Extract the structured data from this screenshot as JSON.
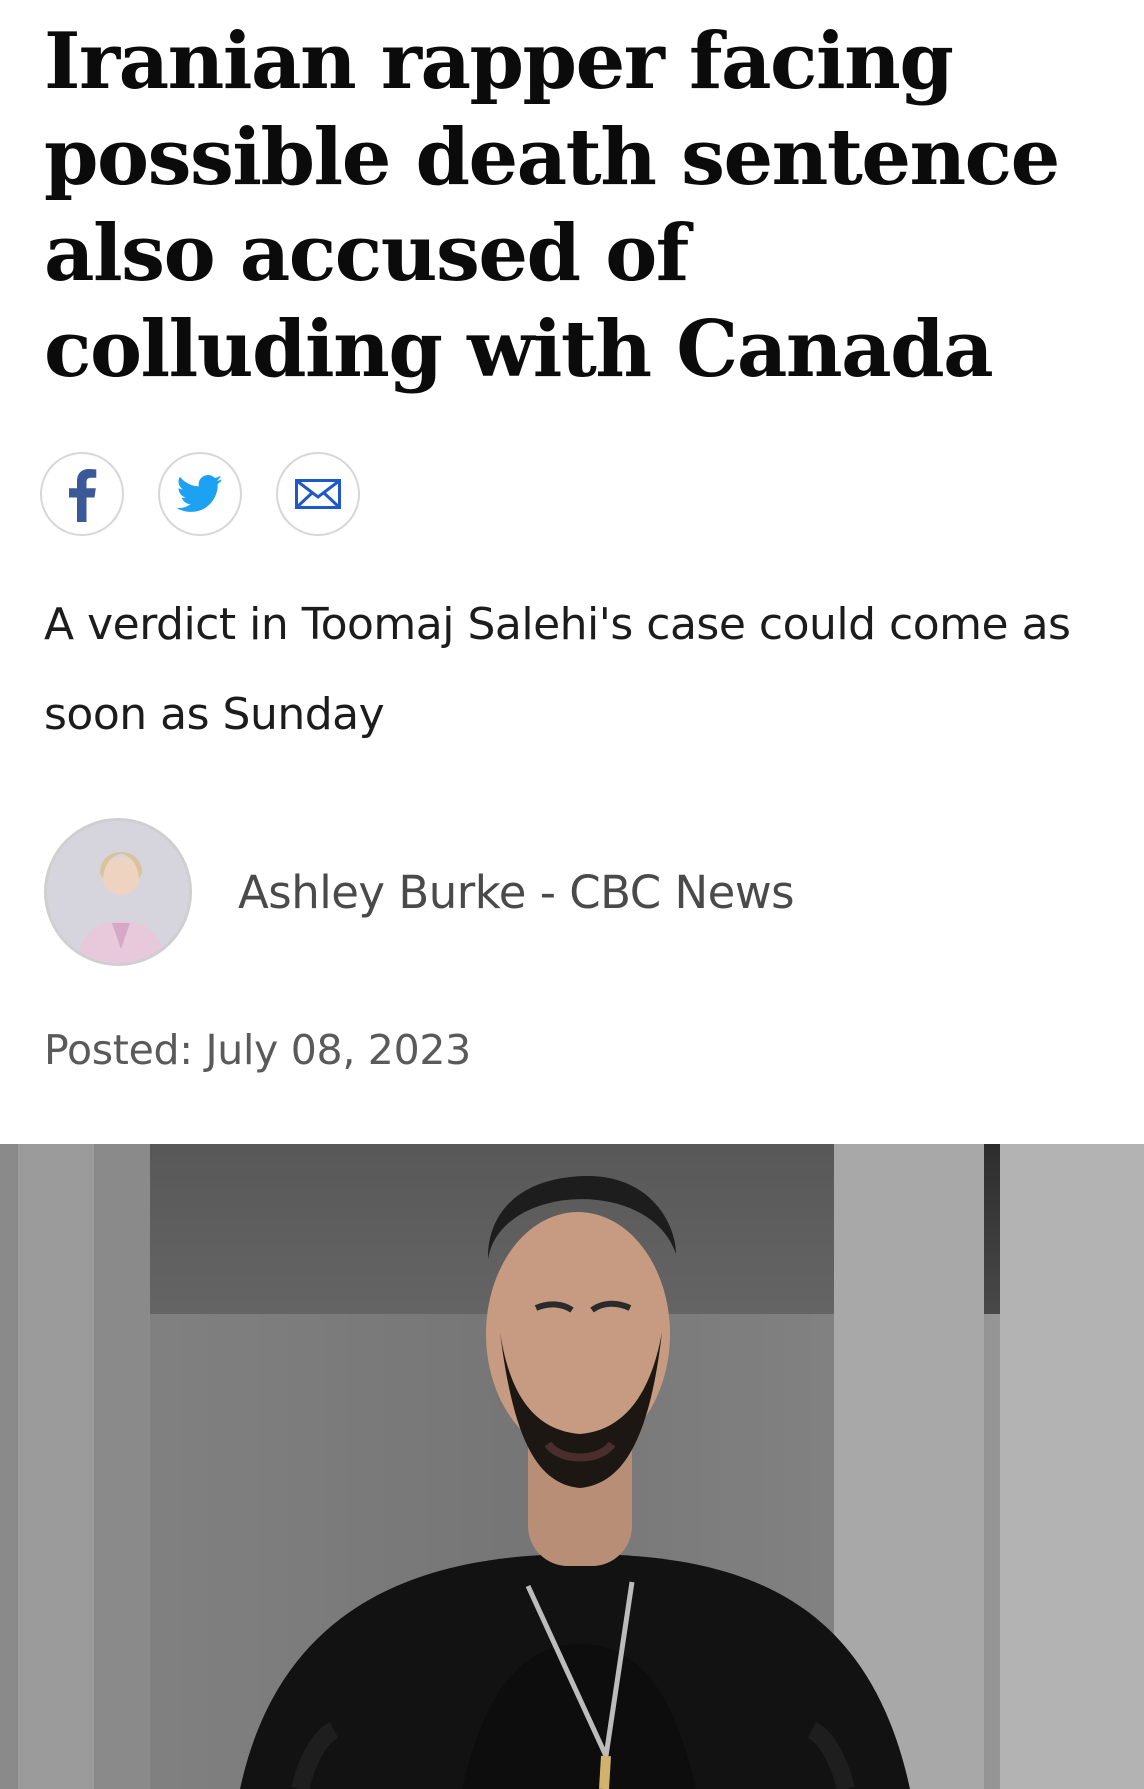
{
  "article": {
    "headline": "Iranian rapper facing possible death sentence also accused of colluding with Canada",
    "dek": "A verdict in Toomaj Salehi's case could come as soon as Sunday",
    "byline": "Ashley Burke - CBC News",
    "posted": "Posted: July 08, 2023"
  },
  "share": {
    "buttons": [
      {
        "icon": "facebook-icon"
      },
      {
        "icon": "twitter-icon"
      },
      {
        "icon": "email-icon"
      }
    ],
    "colors": {
      "facebook": "#3b5998",
      "twitter": "#1da1f2",
      "email": "#1f58c9"
    }
  },
  "images": {
    "author_avatar": "author-photo",
    "hero_image": "hero-photo"
  }
}
